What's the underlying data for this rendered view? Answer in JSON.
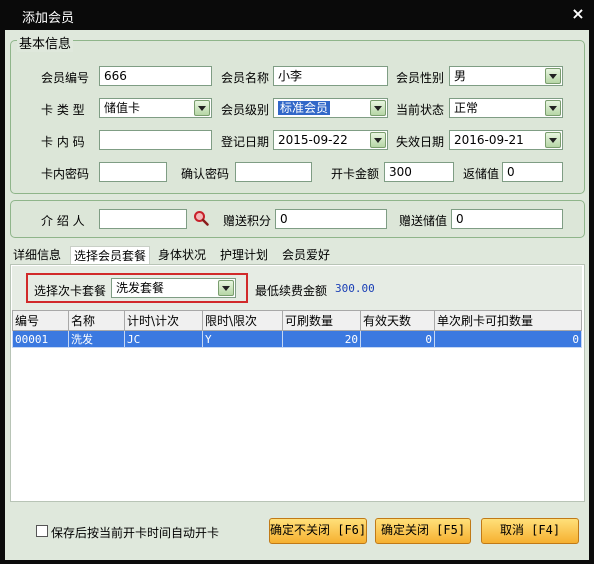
{
  "window": {
    "title": "添加会员",
    "close_label": "×"
  },
  "basic": {
    "group_title": "基本信息",
    "member_no_label": "会员编号",
    "member_no": "666",
    "member_name_label": "会员名称",
    "member_name": "小李",
    "gender_label": "会员性别",
    "gender": "男",
    "card_type_label": "卡 类 型",
    "card_type": "储值卡",
    "level_label": "会员级别",
    "level": "标准会员",
    "status_label": "当前状态",
    "status": "正常",
    "card_code_label": "卡 内 码",
    "card_code": "",
    "reg_date_label": "登记日期",
    "reg_date": "2015-09-22",
    "expire_date_label": "失效日期",
    "expire_date": "2016-09-21",
    "card_pwd_label": "卡内密码",
    "card_pwd": "",
    "confirm_pwd_label": "确认密码",
    "confirm_pwd": "",
    "open_amount_label": "开卡金额",
    "open_amount": "300",
    "rebate_label": "返储值",
    "rebate": "0"
  },
  "referral": {
    "referrer_label": "介 绍 人",
    "referrer": "",
    "bonus_points_label": "赠送积分",
    "bonus_points": "0",
    "bonus_value_label": "赠送储值",
    "bonus_value": "0"
  },
  "tabs": [
    "详细信息",
    "选择会员套餐",
    "身体状况",
    "护理计划",
    "会员爱好"
  ],
  "package": {
    "select_label": "选择次卡套餐",
    "selected": "洗发套餐",
    "min_spend_label": "最低续费金额",
    "min_spend": "300.00"
  },
  "table": {
    "columns": [
      "编号",
      "名称",
      "计时\\计次",
      "限时\\限次",
      "可刷数量",
      "有效天数",
      "单次刷卡可扣数量"
    ],
    "rows": [
      [
        "00001",
        "洗发",
        "JC",
        "Y",
        "20",
        "0",
        "0"
      ]
    ]
  },
  "footer": {
    "auto_open_label": "保存后按当前开卡时间自动开卡",
    "confirm_keep_label": "确定不关闭 [F6]",
    "confirm_close_label": "确定关闭 [F5]",
    "cancel_label": "取消 [F4]"
  },
  "colors": {
    "selected_row": "#3b79e0",
    "button": "#f6b030",
    "highlight_border": "#d12a2a"
  }
}
